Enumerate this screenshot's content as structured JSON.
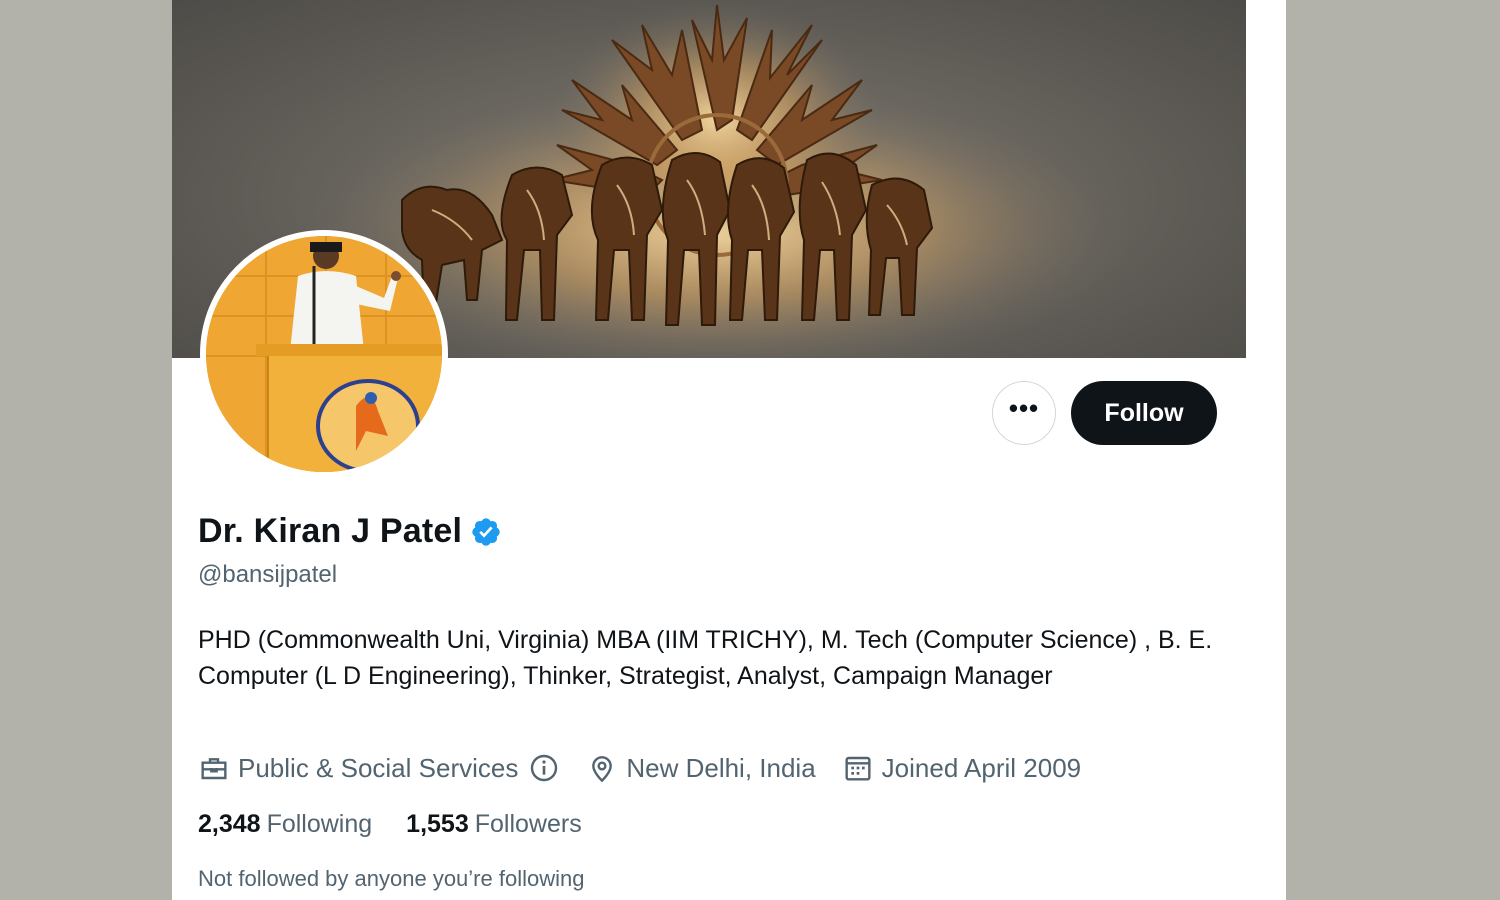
{
  "profile": {
    "display_name": "Dr. Kiran J Patel",
    "handle": "@bansijpatel",
    "verified": true,
    "bio": "PHD (Commonwealth Uni, Virginia) MBA (IIM TRICHY), M. Tech (Computer Science) , B. E. Computer (L D Engineering), Thinker, Strategist, Analyst, Campaign Manager",
    "category": "Public & Social Services",
    "location": "New Delhi, India",
    "joined": "Joined April 2009",
    "following_count": "2,348",
    "following_label": "Following",
    "followers_count": "1,553",
    "followers_label": "Followers",
    "mutuals_note": "Not followed by anyone you’re following"
  },
  "actions": {
    "more_label": "•••",
    "follow_label": "Follow"
  },
  "icons": {
    "more": "more-horizontal-icon",
    "verified": "verified-badge-icon",
    "category": "briefcase-icon",
    "info": "info-icon",
    "location": "location-pin-icon",
    "joined": "calendar-icon"
  },
  "colors": {
    "accent_blue": "#1d9bf0",
    "follow_button_bg": "#0f1419",
    "secondary_text": "#536471",
    "page_background": "#b3b2aa"
  }
}
